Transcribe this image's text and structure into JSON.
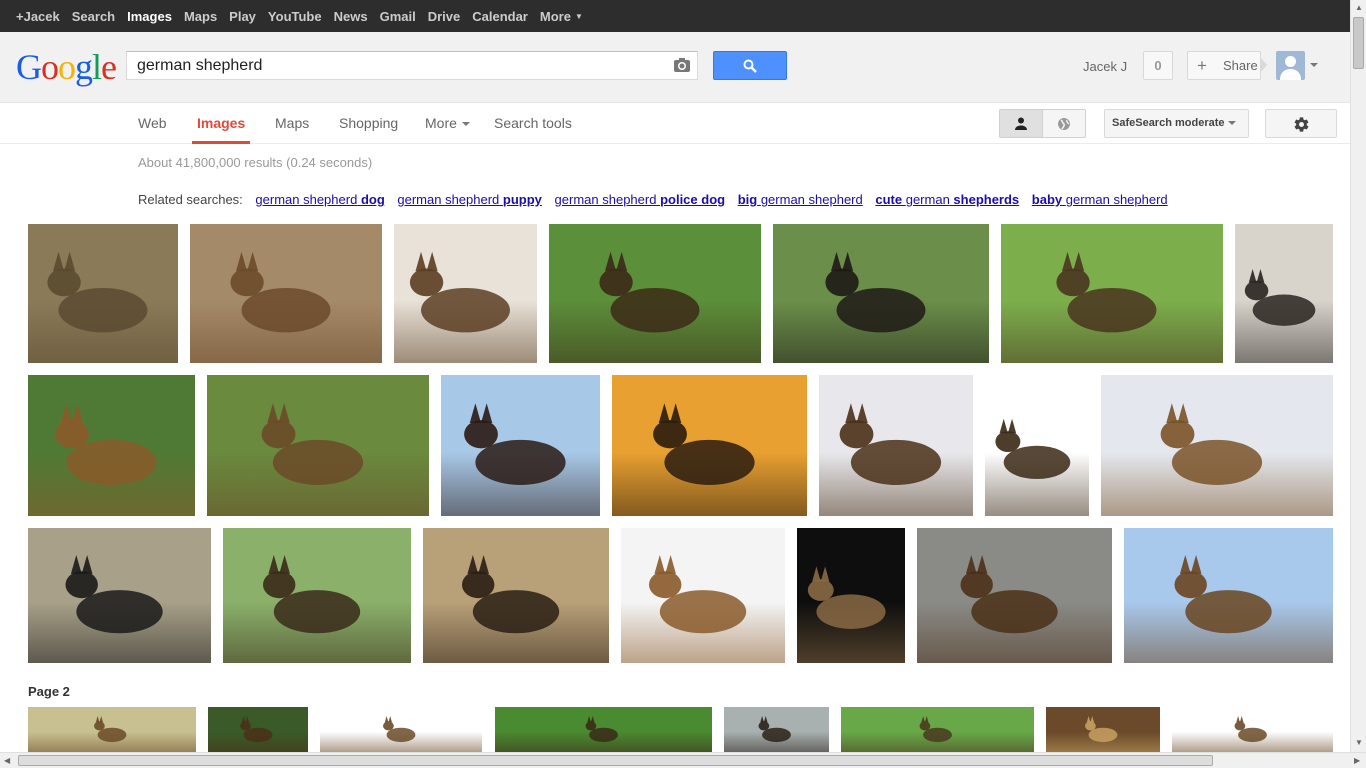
{
  "topbar": {
    "items": [
      "+Jacek",
      "Search",
      "Images",
      "Maps",
      "Play",
      "YouTube",
      "News",
      "Gmail",
      "Drive",
      "Calendar",
      "More"
    ]
  },
  "header": {
    "logo": "Google",
    "search_value": "german shepherd",
    "user_name": "Jacek J",
    "notification_count": "0",
    "share_label": "Share"
  },
  "nav": {
    "tabs": [
      "Web",
      "Images",
      "Maps",
      "Shopping",
      "More",
      "Search tools"
    ],
    "safesearch_label": "SafeSearch moderate"
  },
  "results": {
    "stats": "About 41,800,000 results (0.24 seconds)",
    "related_label": "Related searches:",
    "related": [
      {
        "plain": "german shepherd",
        "bold": "dog",
        "bold_first": false
      },
      {
        "plain": "german shepherd",
        "bold": "puppy",
        "bold_first": false
      },
      {
        "plain": "german shepherd",
        "bold": "police dog",
        "bold_first": false
      },
      {
        "plain": "german shepherd",
        "bold": "big",
        "bold_first": true
      },
      {
        "plain": "german",
        "bold": "cute",
        "bold2": "shepherds",
        "bold_first": true
      },
      {
        "plain": "german shepherd",
        "bold": "baby",
        "bold_first": true
      }
    ],
    "page2_label": "Page 2"
  },
  "colors": {
    "accent_red": "#dd4b39",
    "link_blue": "#1a0dab",
    "search_blue": "#4d90fe",
    "topbar": "#2d2d2d"
  }
}
